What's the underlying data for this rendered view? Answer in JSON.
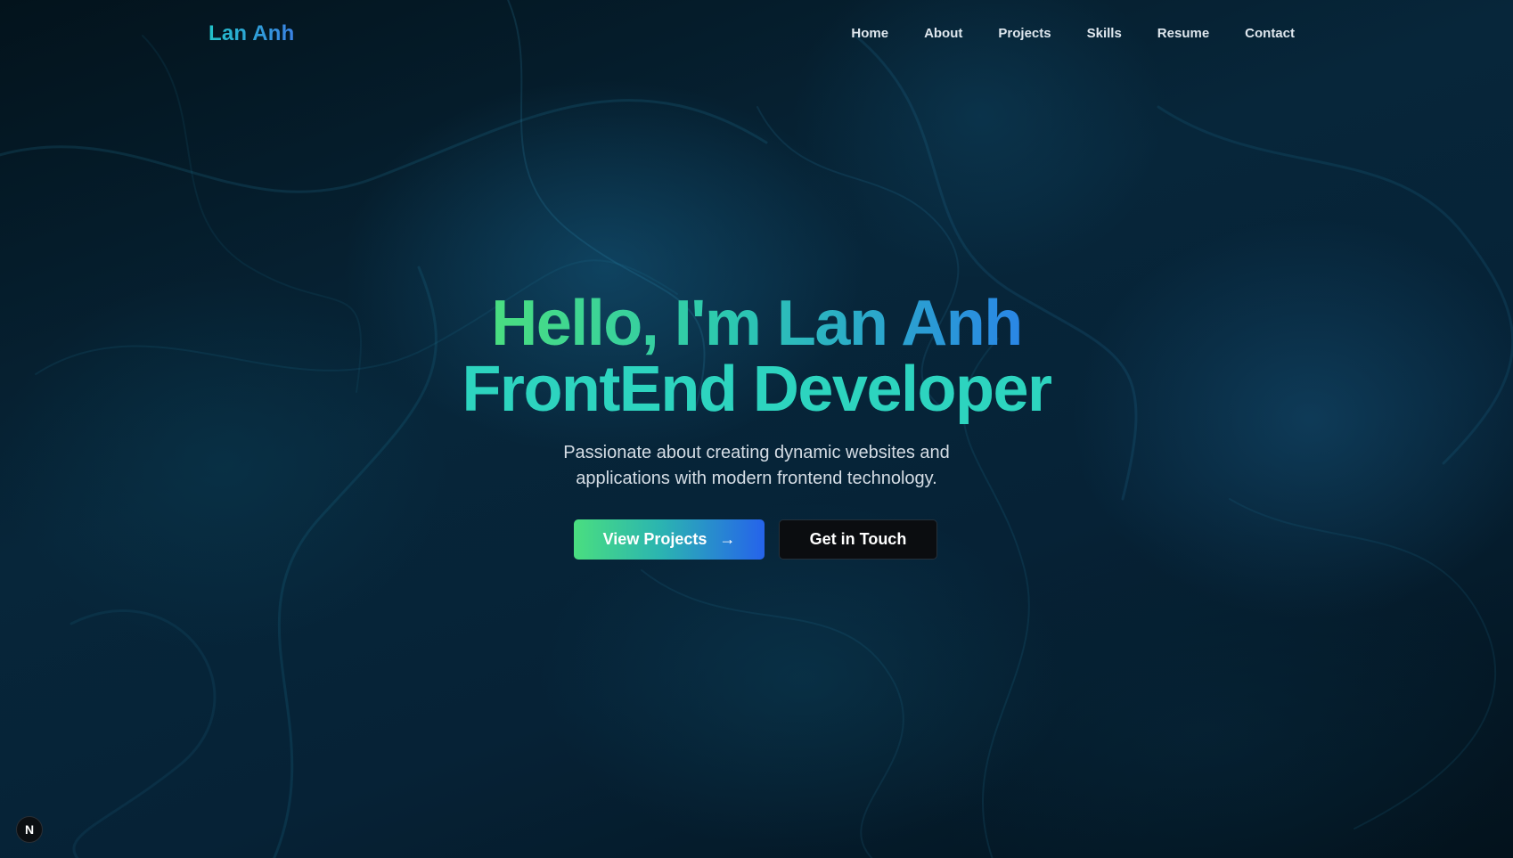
{
  "header": {
    "logo": "Lan Anh",
    "nav": [
      {
        "label": "Home"
      },
      {
        "label": "About"
      },
      {
        "label": "Projects"
      },
      {
        "label": "Skills"
      },
      {
        "label": "Resume"
      },
      {
        "label": "Contact"
      }
    ]
  },
  "hero": {
    "greeting": "Hello, I'm Lan Anh",
    "role": "FrontEnd Developer",
    "subtitle": "Passionate about creating dynamic websites and applications with modern frontend technology.",
    "primary_button": "View Projects",
    "primary_button_icon": "arrow-right-icon",
    "secondary_button": "Get in Touch"
  },
  "badge": {
    "label": "N",
    "icon": "nextjs-logo-icon"
  },
  "colors": {
    "accent_green": "#4ade80",
    "accent_teal": "#2dd4bf",
    "accent_blue": "#2563eb",
    "background": "#04131c"
  }
}
